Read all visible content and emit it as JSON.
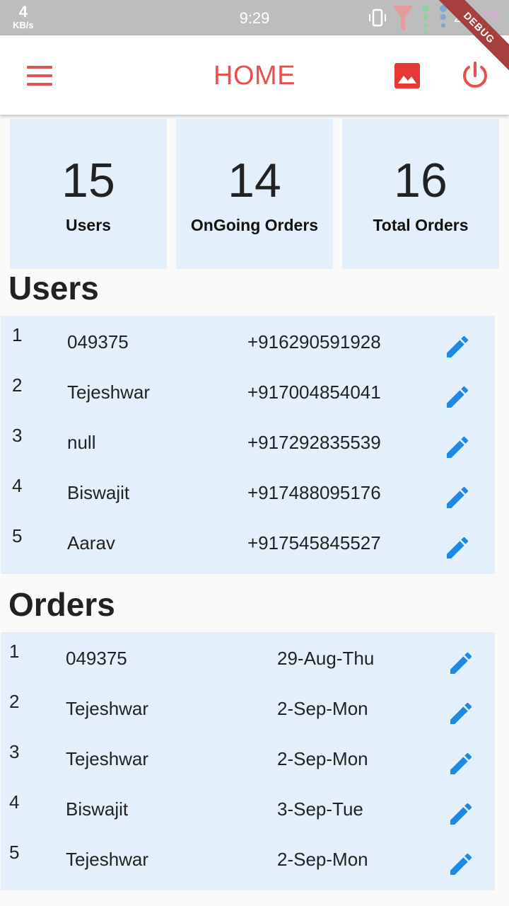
{
  "status_bar": {
    "speed_value": "4",
    "speed_unit": "KB/s",
    "time": "9:29",
    "battery": "24"
  },
  "debug_banner": "DEBUG",
  "appbar": {
    "title": "HOME",
    "menu_icon": "menu-icon",
    "image_icon": "image-icon",
    "power_icon": "power-icon",
    "accent_color": "#e94f4f"
  },
  "stats": [
    {
      "value": "15",
      "label": "Users"
    },
    {
      "value": "14",
      "label": "OnGoing Orders"
    },
    {
      "value": "16",
      "label": "Total Orders"
    }
  ],
  "users_section": {
    "title": "Users",
    "rows": [
      {
        "index": "1",
        "name": "049375",
        "phone": "+916290591928"
      },
      {
        "index": "2",
        "name": "Tejeshwar",
        "phone": "+917004854041"
      },
      {
        "index": "3",
        "name": "null",
        "phone": "+917292835539"
      },
      {
        "index": "4",
        "name": "Biswajit",
        "phone": "+917488095176"
      },
      {
        "index": "5",
        "name": "Aarav",
        "phone": "+917545845527"
      }
    ]
  },
  "orders_section": {
    "title": "Orders",
    "rows": [
      {
        "index": "1",
        "name": "049375",
        "date": "29-Aug-Thu"
      },
      {
        "index": "2",
        "name": "Tejeshwar",
        "date": "2-Sep-Mon"
      },
      {
        "index": "3",
        "name": "Tejeshwar",
        "date": "2-Sep-Mon"
      },
      {
        "index": "4",
        "name": "Biswajit",
        "date": "3-Sep-Tue"
      },
      {
        "index": "5",
        "name": "Tejeshwar",
        "date": "2-Sep-Mon"
      }
    ]
  },
  "colors": {
    "card_bg": "#e3f0fb",
    "edit_icon": "#1e88e5"
  }
}
